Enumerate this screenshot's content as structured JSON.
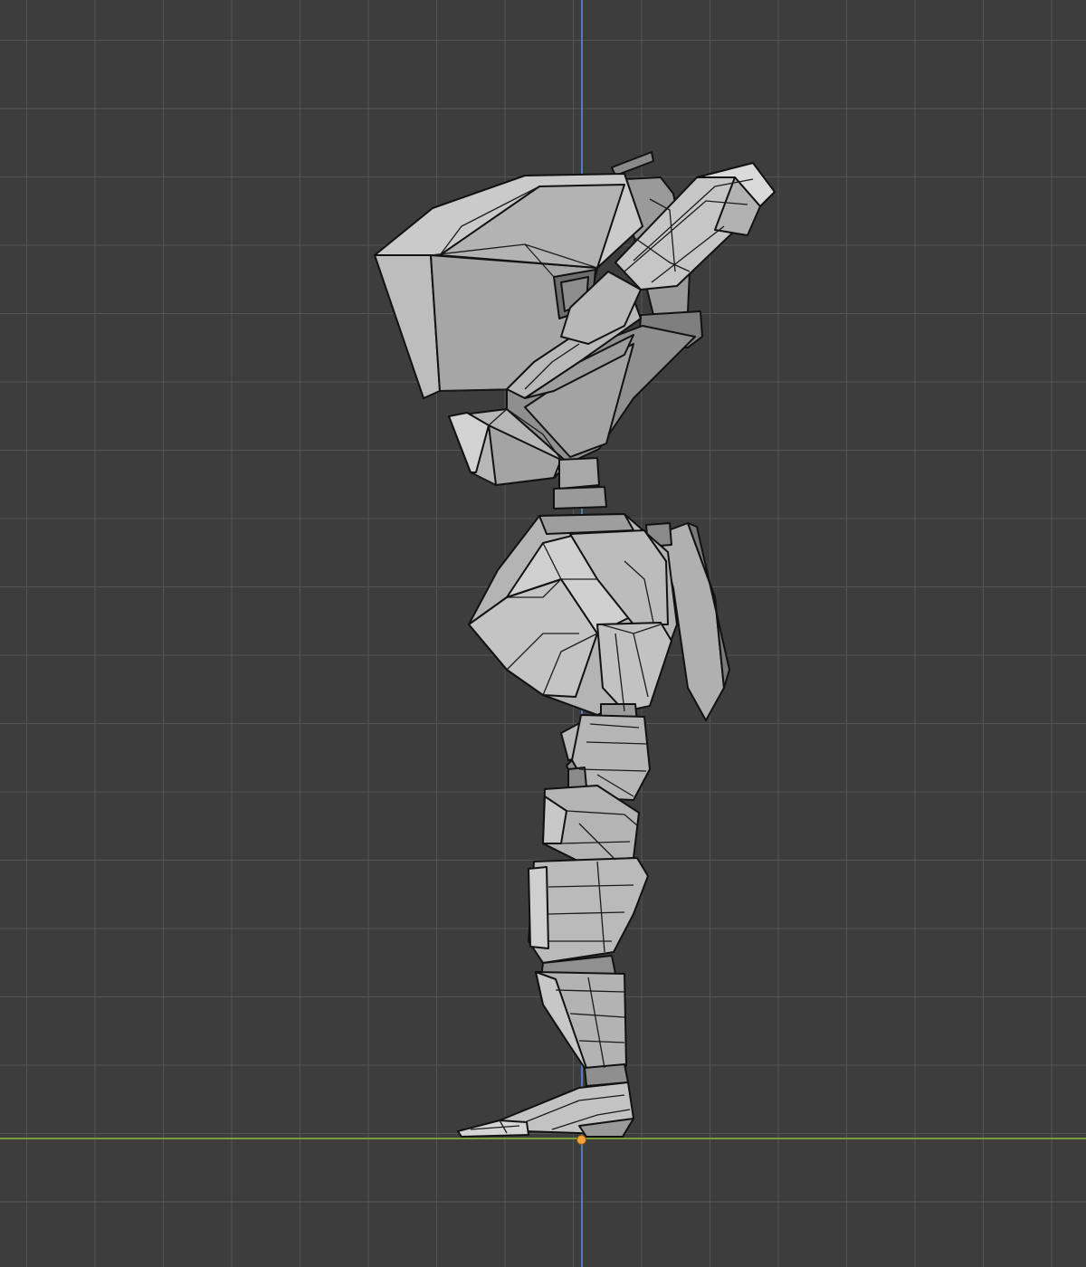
{
  "viewport": {
    "mode": "right-orthographic",
    "grid_visible": true,
    "colors": {
      "background": "#3d3d3d",
      "grid_line": "#555555",
      "axis_z": "#4f7fb8",
      "axis_y": "#7a9c3a",
      "origin": "#f2a33a",
      "mesh_light": "#c9c9c9",
      "mesh_mid": "#a9a9a9",
      "mesh_dark": "#7f7f7f",
      "edge": "#111111"
    }
  },
  "model": {
    "object": "low-poly-robot-character",
    "view": "side"
  }
}
